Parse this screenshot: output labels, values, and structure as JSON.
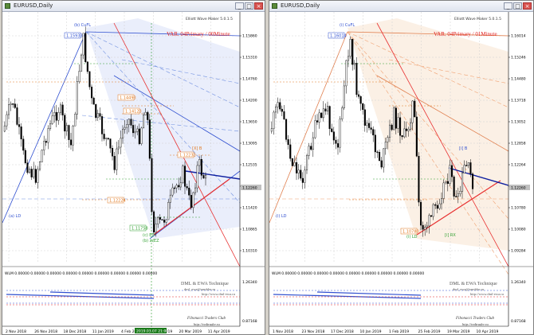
{
  "left": {
    "title": "EURUSD,Daily",
    "var_label": "VAR. 04Primary / 00Minute",
    "indicator_tag": "Elliott Wave Maker 5.0.1.5",
    "wave_labels": {
      "b_cuel": "(b) CuFL",
      "a_ld": "(a) LD",
      "c_ed": "(c) ED",
      "b_zz": "(b) zzEZ",
      "ax_b": "[X] B"
    },
    "box_price_labels": [
      "1.15933",
      "1.14493",
      "1.14123",
      "1.12224",
      "1.11758",
      "1.12232"
    ],
    "price_axis": [
      "1.15860",
      "1.15310",
      "1.14760",
      "1.14200",
      "1.13650",
      "1.13095",
      "1.12535",
      "1.11980",
      "1.11420",
      "1.10865",
      "1.10310",
      "1.26340",
      "0.87168"
    ],
    "current_price": "1.12260",
    "date_axis": [
      "2 Nov 2018",
      "26 Nov 2018",
      "18 Dec 2018",
      "11 Jan 2019",
      "4 Feb 2019",
      "26 Feb 2019",
      "20 Mar 2019",
      "11 Apr 2019"
    ],
    "cursor_date": "2019.03.07 21:00",
    "sub_header": "WLM 0.00000 0.00000 0.00000 0.00000 0.00000 0.00000 0.00000 0.00000 0.00000",
    "dml_title": "DML & EWA Technique",
    "dml_email": "dml_ewa@rambler.ru",
    "dml_site": "http://www.dml-ewa.ru",
    "fib_club": "Fibonacci  Traders  Club",
    "redtrader": "http://redtrader.ru"
  },
  "right": {
    "title": "EURUSD,Daily",
    "var_label": "VAR. 04Primary / 01Minute",
    "indicator_tag": "Elliott Wave Maker 5.0.1.5",
    "wave_labels": {
      "b_cuel": "(i) CuFL",
      "a_ld": "(i) LD",
      "c_ed": "(i) LD",
      "b_zz": "[i] RX",
      "ax_b": "[i] B"
    },
    "price_axis": [
      "1.16014",
      "1.15246",
      "1.14480",
      "1.13718",
      "1.13052",
      "1.12858",
      "1.12264",
      "1.11548",
      "1.10780",
      "1.10080",
      "1.09284",
      "1.26340",
      "0.87168"
    ],
    "current_price": "1.12260",
    "date_axis": [
      "1 Nov 2018",
      "23 Nov 2018",
      "17 Dec 2018",
      "10 Jan 2019",
      "1 Feb 2019",
      "25 Feb 2019",
      "19 Mar 2019",
      "10 Apr 2019"
    ],
    "sub_header": "WLM 0.00000 0.00000 0.00000 0.00000 0.00000 0.00000 0.00000 0.00000 0.00000",
    "dml_title": "DML & EWA Technique",
    "dml_email": "dml_ewa@rambler.ru",
    "dml_site": "http://www.dml-ewa.ru",
    "fib_club": "Fibonacci  Traders  Club",
    "redtrader": "http://redtrader.ru"
  },
  "colors": {
    "bull": "#ffffff",
    "bear": "#000000",
    "grid": "#c8c8c8",
    "blue_zone": "#e8ecfb",
    "orange_zone": "#fbeee2",
    "accent_red": "#e00000",
    "accent_blue": "#1030c0"
  }
}
